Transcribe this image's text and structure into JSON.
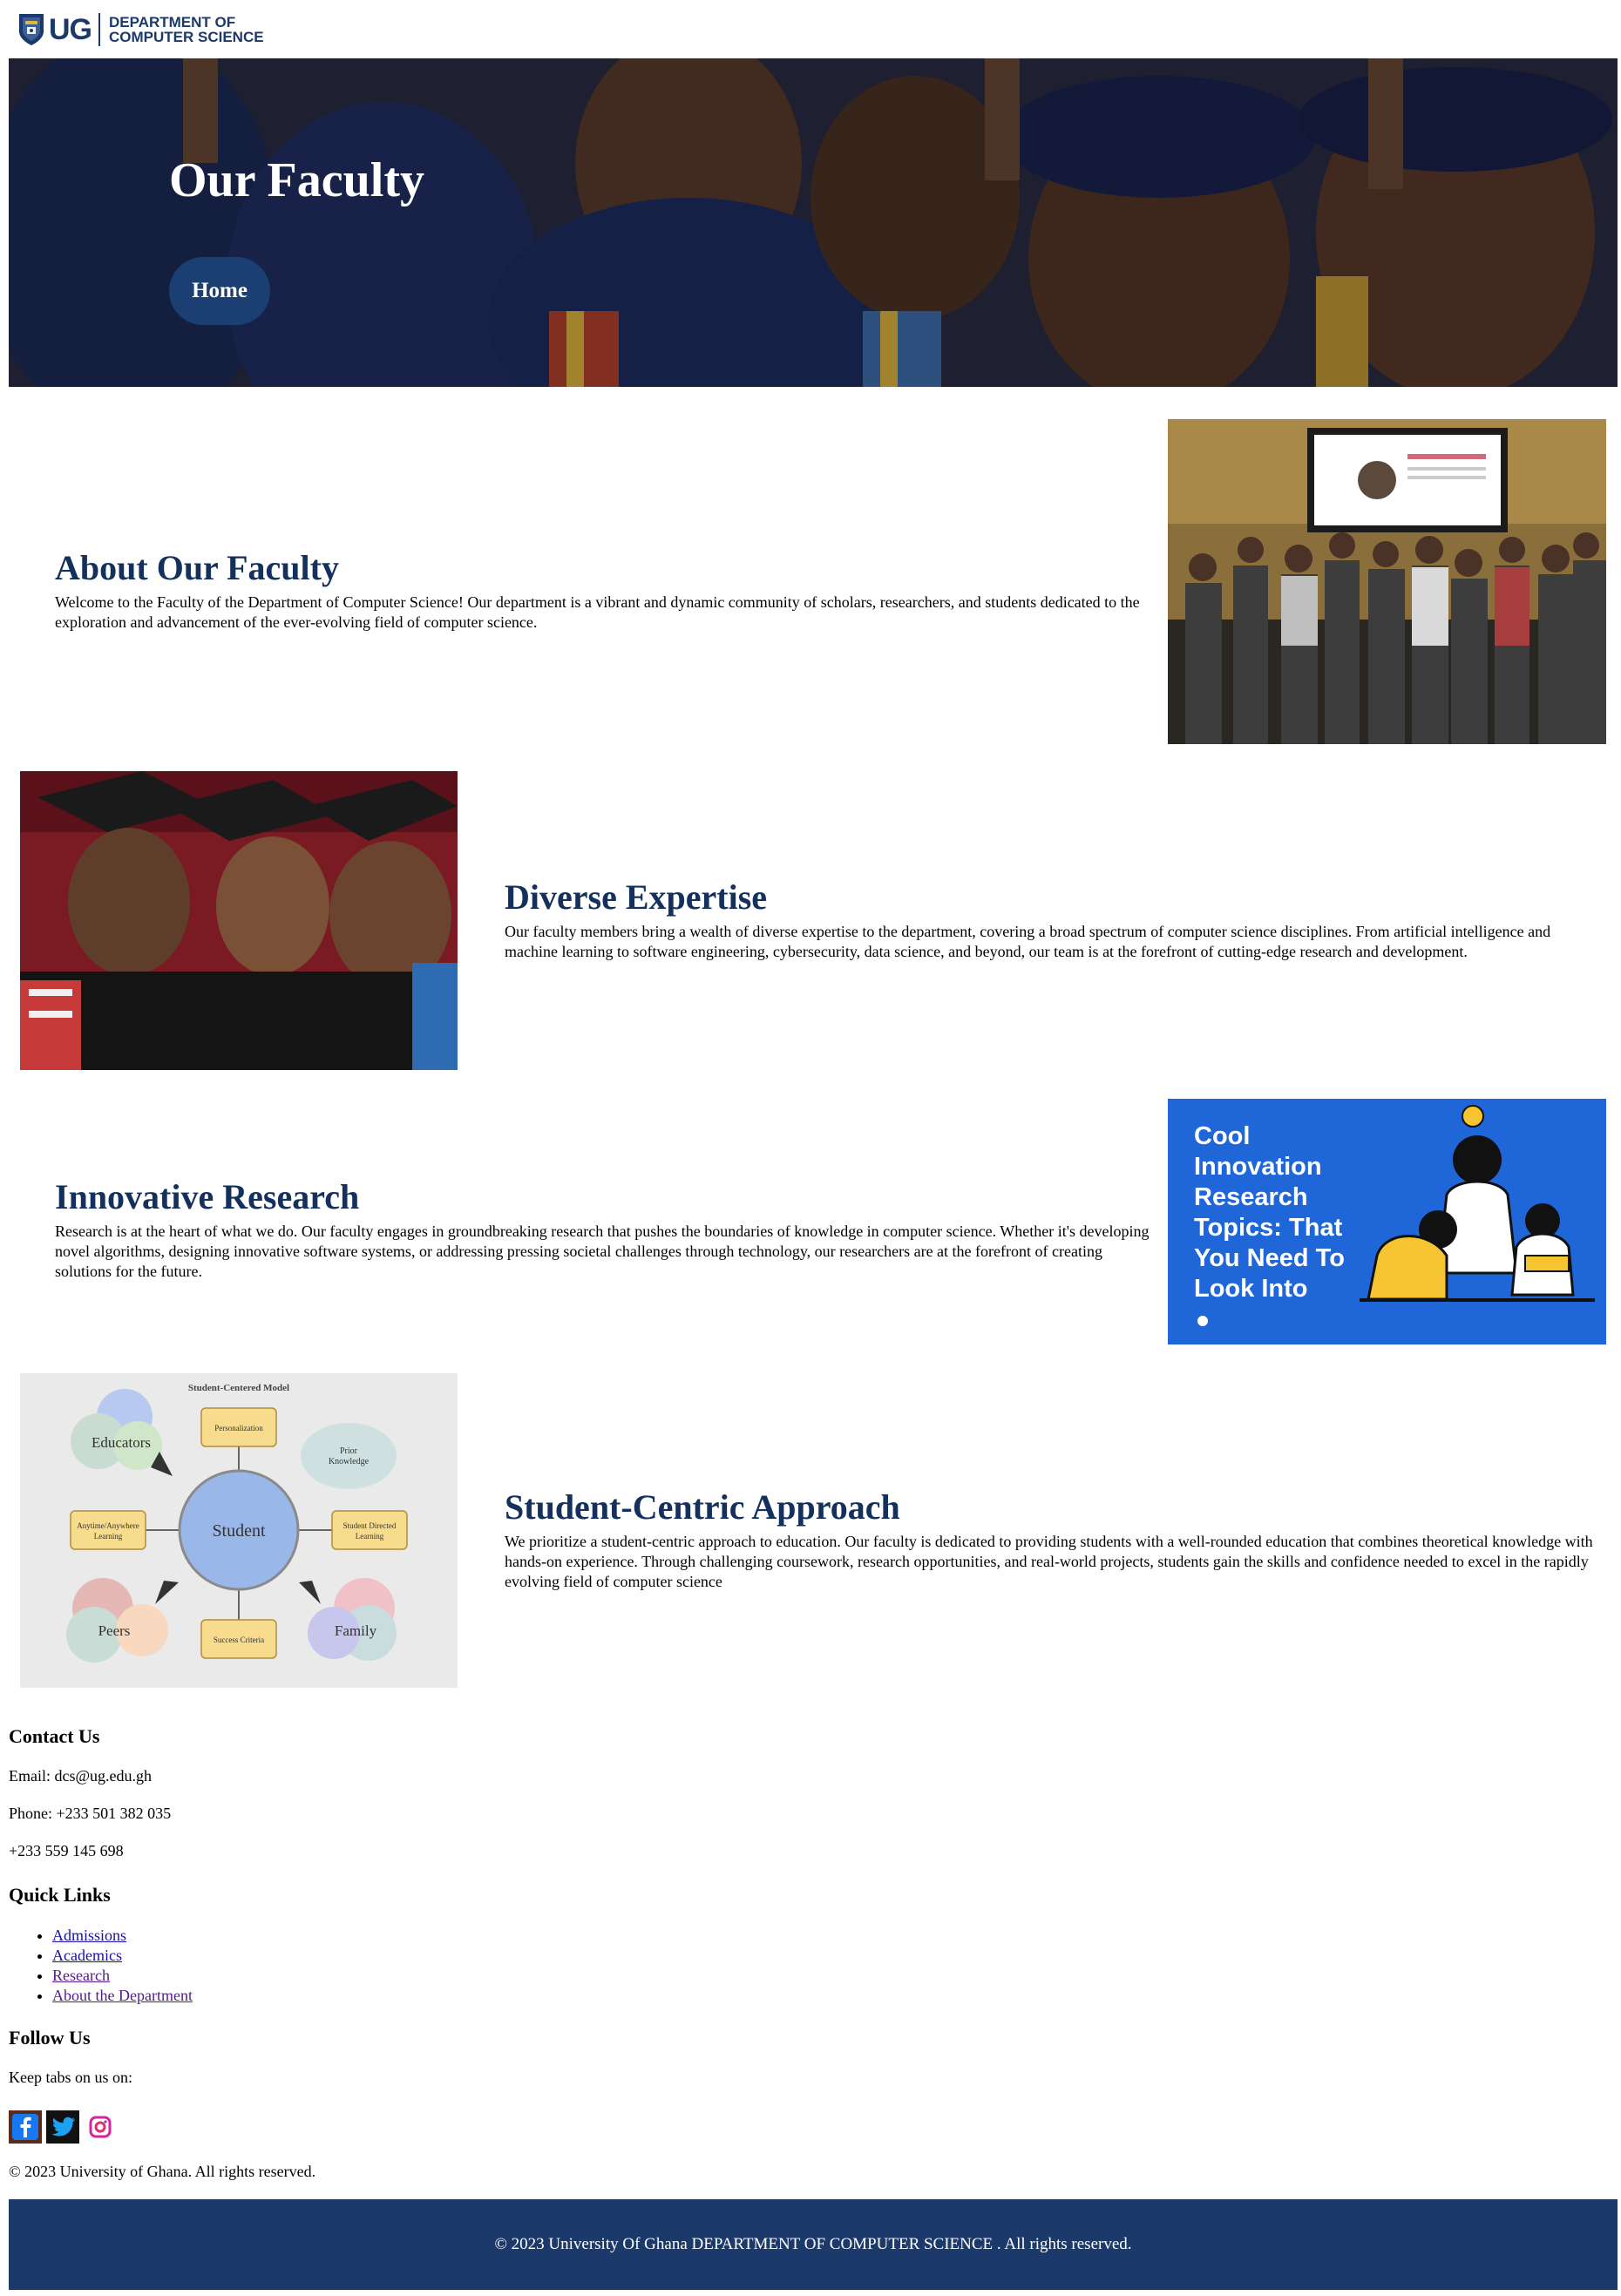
{
  "header": {
    "logo_text": "UG",
    "dept_line1": "DEPARTMENT OF",
    "dept_line2": "COMPUTER SCIENCE"
  },
  "hero": {
    "title": "Our Faculty",
    "button_label": "Home"
  },
  "sections": [
    {
      "heading": "About Our Faculty",
      "text": "Welcome to the Faculty of the Department of Computer Science! Our department is a vibrant and dynamic community of scholars, researchers, and students dedicated to the exploration and advancement of the ever-evolving field of computer science."
    },
    {
      "heading": "Diverse Expertise",
      "text": "Our faculty members bring a wealth of diverse expertise to the department, covering a broad spectrum of computer science disciplines. From artificial intelligence and machine learning to software engineering, cybersecurity, data science, and beyond, our team is at the forefront of cutting-edge research and development."
    },
    {
      "heading": "Innovative Research",
      "text": "Research is at the heart of what we do. Our faculty engages in groundbreaking research that pushes the boundaries of knowledge in computer science. Whether it's developing novel algorithms, designing innovative software systems, or addressing pressing societal challenges through technology, our researchers are at the forefront of creating solutions for the future."
    },
    {
      "heading": "Student-Centric Approach",
      "text": "We prioritize a student-centric approach to education. Our faculty is dedicated to providing students with a well-rounded education that combines theoretical knowledge with hands-on experience. Through challenging coursework, research opportunities, and real-world projects, students gain the skills and confidence needed to excel in the rapidly evolving field of computer science"
    }
  ],
  "research_image": {
    "line1": "Cool",
    "line2": "Innovation",
    "line3": "Research",
    "line4": "Topics: That",
    "line5": "You Need To",
    "line6": "Look Into"
  },
  "model_image": {
    "title": "Student-Centered Model",
    "center": "Student",
    "educators": "Educators",
    "peers": "Peers",
    "family": "Family",
    "personalization": "Personalization",
    "prior1": "Prior",
    "prior2": "Knowledge",
    "anytime1": "Anytime/Anywhere",
    "anytime2": "Learning",
    "directed1": "Student Directed",
    "directed2": "Learning",
    "success": "Success Criteria"
  },
  "contact": {
    "heading": "Contact Us",
    "email": "Email: dcs@ug.edu.gh",
    "phone1": "Phone: +233 501 382 035",
    "phone2": "+233 559 145 698"
  },
  "quick_links": {
    "heading": "Quick Links",
    "items": [
      "Admissions",
      "Academics",
      "Research",
      "About the Department"
    ]
  },
  "follow": {
    "heading": "Follow Us",
    "text": "Keep tabs on us on:",
    "icons": [
      "facebook-icon",
      "twitter-icon",
      "instagram-icon"
    ]
  },
  "copyright": "© 2023 University of Ghana. All rights reserved.",
  "bottom_bar": "© 2023 University Of Ghana DEPARTMENT OF COMPUTER SCIENCE . All rights reserved.",
  "colors": {
    "brand": "#1b3a6b",
    "heading": "#14305d",
    "button": "#1c3f73",
    "research_bg": "#1f66d9"
  }
}
